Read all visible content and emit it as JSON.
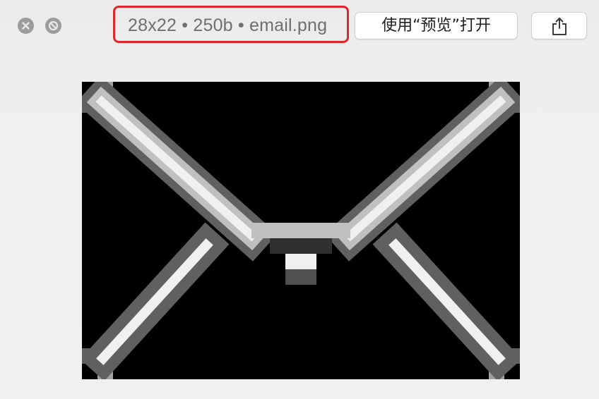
{
  "window": {
    "controls": [
      {
        "name": "close",
        "icon": "close-icon"
      },
      {
        "name": "fullscreen",
        "icon": "fullscreen-disabled-icon"
      }
    ],
    "file_info": "28x22 • 250b • email.png",
    "open_button_label": "使用“预览”打开",
    "share_icon": "share-icon"
  },
  "preview": {
    "file_name": "email.png",
    "image_size": "28x22",
    "subject_icon": "envelope-icon",
    "colors": {
      "background": "#000000",
      "light": "#f0f0f0",
      "mid": "#a0a0a0",
      "dark": "#404040"
    }
  },
  "highlight_color": "#e0262c"
}
